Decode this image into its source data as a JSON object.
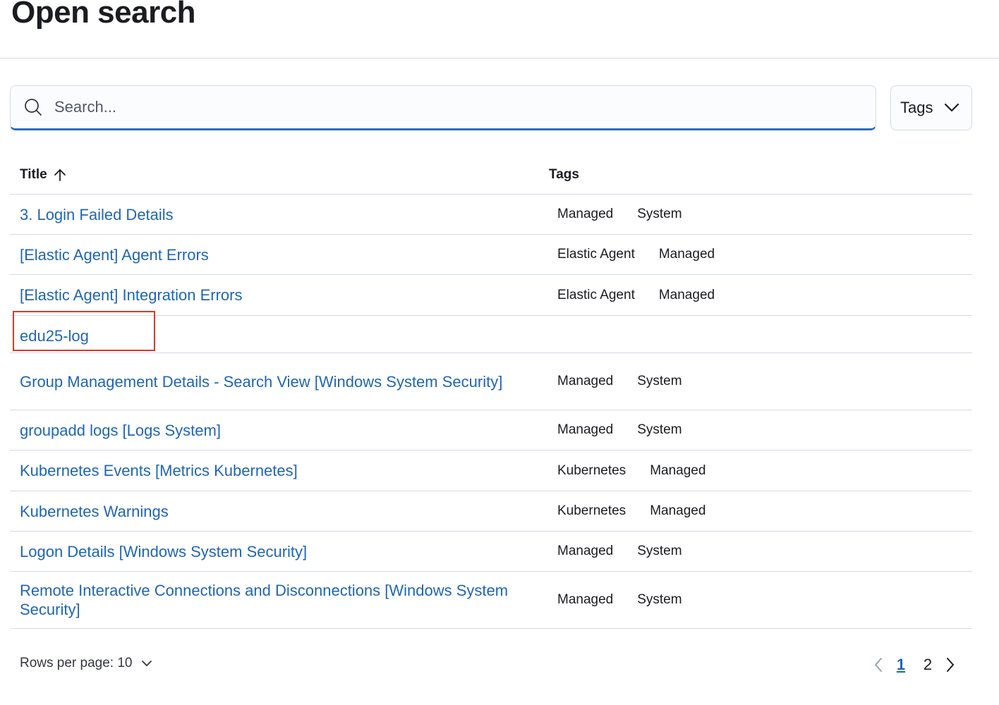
{
  "header": {
    "title": "Open search"
  },
  "search": {
    "placeholder": "Search..."
  },
  "filter": {
    "tags_label": "Tags"
  },
  "table": {
    "columns": {
      "title": "Title",
      "tags": "Tags"
    },
    "rows": [
      {
        "title": "3. Login Failed Details",
        "tags": [
          "Managed",
          "System"
        ]
      },
      {
        "title": "[Elastic Agent] Agent Errors",
        "tags": [
          "Elastic Agent",
          "Managed"
        ]
      },
      {
        "title": "[Elastic Agent] Integration Errors",
        "tags": [
          "Elastic Agent",
          "Managed"
        ]
      },
      {
        "title": "edu25-log",
        "tags": []
      },
      {
        "title": "Group Management Details - Search View [Windows System Security]",
        "tags": [
          "Managed",
          "System"
        ]
      },
      {
        "title": "groupadd logs [Logs System]",
        "tags": [
          "Managed",
          "System"
        ]
      },
      {
        "title": "Kubernetes Events [Metrics Kubernetes]",
        "tags": [
          "Kubernetes",
          "Managed"
        ]
      },
      {
        "title": "Kubernetes Warnings",
        "tags": [
          "Kubernetes",
          "Managed"
        ]
      },
      {
        "title": "Logon Details [Windows System Security]",
        "tags": [
          "Managed",
          "System"
        ]
      },
      {
        "title": "Remote Interactive Connections and Disconnections [Windows System Security]",
        "tags": [
          "Managed",
          "System"
        ]
      }
    ]
  },
  "footer": {
    "rows_per_page": "Rows per page: 10",
    "pages": [
      "1",
      "2"
    ],
    "current_page": "1"
  },
  "colors": {
    "link": "#1f66b4",
    "accent_underline": "#2f6db8",
    "highlight": "#d93a28"
  }
}
